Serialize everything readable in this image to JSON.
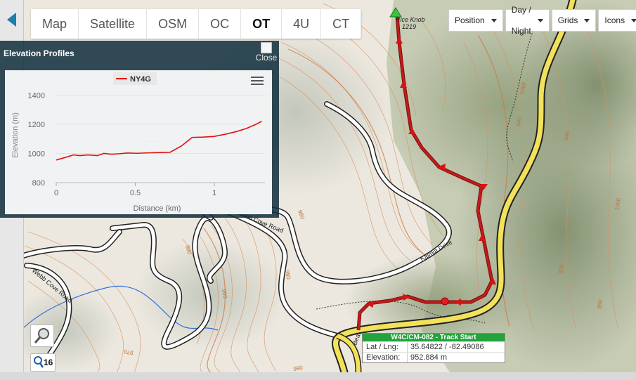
{
  "layer_tabs": [
    "Map",
    "Satellite",
    "OSM",
    "OC",
    "OT",
    "4U",
    "CT"
  ],
  "active_layer": "OT",
  "toolbar": {
    "position": "Position",
    "day_night": "Day / Night",
    "grids": "Grids",
    "icons": "Icons"
  },
  "elevation_panel": {
    "title": "Elevation Profiles",
    "close_label": "Close"
  },
  "chart_data": {
    "type": "line",
    "xlabel": "Distance (km)",
    "ylabel": "Elevation (m)",
    "xlim": [
      0,
      1.32
    ],
    "ylim": [
      800,
      1450
    ],
    "x_ticks": [
      0,
      0.5,
      1
    ],
    "y_ticks": [
      800,
      1000,
      1200,
      1400
    ],
    "series": [
      {
        "name": "NY4G",
        "color": "#e01010",
        "x": [
          0,
          0.05,
          0.11,
          0.15,
          0.2,
          0.26,
          0.3,
          0.35,
          0.4,
          0.45,
          0.51,
          0.58,
          0.65,
          0.72,
          0.79,
          0.86,
          0.93,
          1.0,
          1.07,
          1.14,
          1.2,
          1.26,
          1.3
        ],
        "y": [
          955,
          970,
          990,
          985,
          990,
          985,
          1000,
          995,
          998,
          1003,
          1001,
          1004,
          1006,
          1008,
          1050,
          1110,
          1112,
          1117,
          1132,
          1150,
          1170,
          1198,
          1220
        ]
      }
    ]
  },
  "map": {
    "summit_name": "Rice Knob",
    "summit_elevation": "1219",
    "road_labels": [
      "Webb Cove Road",
      "Webb Cove Road",
      "Kalmia Drive",
      "Beal"
    ],
    "contour_labels": [
      "980",
      "980",
      "900",
      "880",
      "970",
      "990",
      "940",
      "940",
      "1060",
      "1000",
      "920",
      "850"
    ]
  },
  "zoom_level": "16",
  "track_info": {
    "title": "W4C/CM-082 - Track Start",
    "lat_lng_label": "Lat / Lng:",
    "lat_lng": "35.64822 / -82.49086",
    "elevation_label": "Elevation:",
    "elevation": "952.884 m"
  }
}
